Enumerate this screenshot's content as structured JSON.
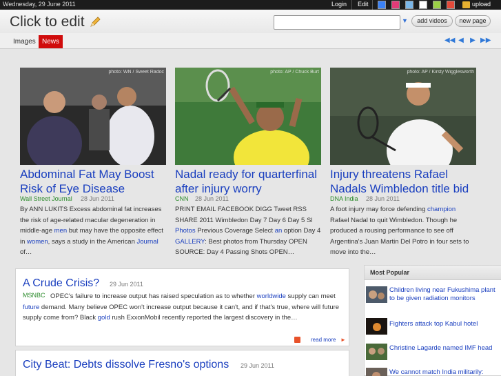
{
  "topbar": {
    "date": "Wednesday, 29 June 2011",
    "login": "Login",
    "edit": "Edit",
    "swatches": [
      "#3b82f6",
      "#e23b78",
      "#7ab6e8",
      "#ffffff",
      "#9ad046",
      "#e34a3a",
      "#666666"
    ],
    "upload": "upload"
  },
  "header": {
    "title": "Click to edit",
    "search_value": "",
    "add_videos": "add videos",
    "new_page": "new page"
  },
  "tabs": [
    {
      "label": "Images",
      "active": false
    },
    {
      "label": "News",
      "active": true
    }
  ],
  "featured": [
    {
      "photo_credit": "photo: WN / Sweet Radoc",
      "title": "Abdominal Fat May Boost Risk of Eye Disease",
      "source": "Wall Street Journal",
      "date": "28 Jun 2011",
      "body_parts": [
        {
          "text": "By ANN LUKITS Excess abdominal fat increases the risk of age-related macular degeneration in middle-age ",
          "link": false
        },
        {
          "text": "men",
          "link": true
        },
        {
          "text": " but may have the opposite effect in ",
          "link": false
        },
        {
          "text": "women",
          "link": true
        },
        {
          "text": ", says a study in the American ",
          "link": false
        },
        {
          "text": "Journal",
          "link": true
        },
        {
          "text": " of…",
          "link": false
        }
      ]
    },
    {
      "photo_credit": "photo: AP / Chuck Burt",
      "title": "Nadal ready for quarterfinal after injury worry",
      "source": "CNN",
      "date": "28 Jun 2011",
      "body_parts": [
        {
          "text": "PRINT EMAIL FACEBOOK DIGG Tweet RSS SHARE 2011 Wimbledon Day 7 Day 6 Day 5 Sl ",
          "link": false
        },
        {
          "text": "Photos",
          "link": true
        },
        {
          "text": " Previous Coverage Select ",
          "link": false
        },
        {
          "text": "an",
          "link": true
        },
        {
          "text": " option Day 4 ",
          "link": false
        },
        {
          "text": "GALLERY",
          "link": true
        },
        {
          "text": ": Best photos from Thursday OPEN SOURCE: Day 4 Passing Shots OPEN…",
          "link": false
        }
      ]
    },
    {
      "photo_credit": "photo: AP / Kirsty Wigglesworth",
      "title": "Injury threatens Rafael Nadals Wimbledon title bid",
      "source": "DNA India",
      "date": "28 Jun 2011",
      "body_parts": [
        {
          "text": "A foot injury may force defending ",
          "link": false
        },
        {
          "text": "champion",
          "link": true
        },
        {
          "text": " Rafael Nadal to quit Wimbledon. Though he produced a rousing performance to see off Argentina's Juan Martin Del Potro in four sets to move into the…",
          "link": false
        }
      ]
    }
  ],
  "news": [
    {
      "title": "A Crude Crisis?",
      "date": "29 Jun 2011",
      "source": "MSNBC",
      "body_parts": [
        {
          "text": "OPEC's failure to increase output has raised speculation as to whether ",
          "link": false
        },
        {
          "text": "worldwide",
          "link": true
        },
        {
          "text": " supply can meet ",
          "link": false
        },
        {
          "text": "future",
          "link": true
        },
        {
          "text": " demand. Many believe OPEC won't increase output because it can't, and if that's true, where will future supply come from? Black ",
          "link": false
        },
        {
          "text": "gold",
          "link": true
        },
        {
          "text": " rush ExxonMobil recently reported the largest discovery in the…",
          "link": false
        }
      ],
      "read_more": "read more"
    },
    {
      "title": "City Beat: Debts dissolve Fresno's options",
      "date": "29 Jun 2011"
    }
  ],
  "popular": {
    "heading": "Most Popular",
    "items": [
      {
        "text": "Children living near Fukushima plant to be given radiation monitors"
      },
      {
        "text": "Fighters attack top Kabul hotel"
      },
      {
        "text": "Christine Lagarde named IMF head"
      },
      {
        "text": "We cannot match India militarily:"
      }
    ]
  }
}
